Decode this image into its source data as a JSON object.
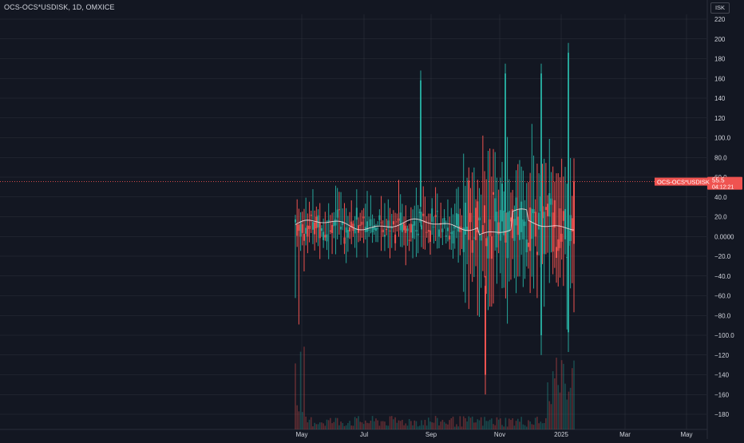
{
  "header": {
    "title": "OCS-OCS*USDISK, 1D, OMXICE",
    "currency": "ISK"
  },
  "price_tag": {
    "label": "OCS-OCS*USDISK",
    "value": "55.5",
    "countdown": "04:12:21"
  },
  "colors": {
    "background": "#131722",
    "grid": "#363a45",
    "up": "#26a69a",
    "down": "#ef5350",
    "ma_line": "#f7dede",
    "axis_text": "#d1d4dc",
    "price_line": "#ef5350"
  },
  "chart_data": {
    "type": "candlestick",
    "title": "OCS-OCS*USDISK, 1D, OMXICE",
    "y_ticks": [
      "220",
      "200",
      "180",
      "160",
      "140",
      "120",
      "100.0",
      "80.0",
      "60.0",
      "40.0",
      "20.0",
      "0.0000",
      "−20.0",
      "−40.0",
      "−60.0",
      "−80.0",
      "−100.0",
      "−120",
      "−140",
      "−160",
      "−180"
    ],
    "ylim": [
      -190,
      228
    ],
    "x_ticks": [
      "May",
      "Jul",
      "Sep",
      "Nov",
      "2025",
      "Mar",
      "May"
    ],
    "last_value": 55.5,
    "spikes": [
      {
        "date": "Aug 22",
        "high": 168,
        "low": 10
      },
      {
        "date": "Oct 28",
        "high": -40,
        "low": -160
      },
      {
        "date": "Nov 12",
        "high": 175,
        "low": 5
      },
      {
        "date": "Dec 26",
        "high": 175,
        "low": -120
      },
      {
        "date": "Jan 02",
        "high": 196,
        "low": -117
      }
    ],
    "grid": true,
    "series": [
      {
        "name": "",
        "type": "candles"
      },
      {
        "name": "",
        "type": "moving-average"
      },
      {
        "name": "",
        "type": "volume"
      }
    ]
  }
}
